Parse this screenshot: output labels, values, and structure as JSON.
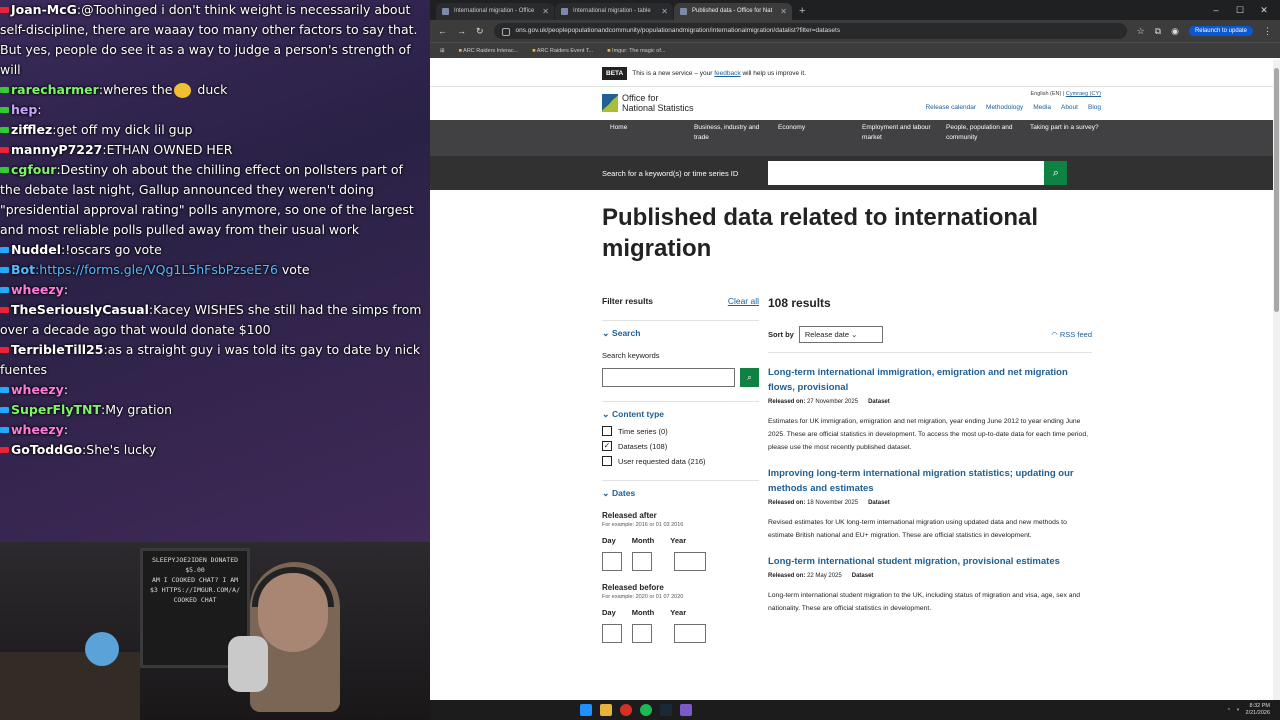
{
  "chat": {
    "messages": [
      {
        "user": "Joan-McG",
        "color": "#ffffff",
        "tick": "#e23",
        "text": ":@Toohinged i don't think weight is necessarily about self-discipline, there are waaay too many other factors to say that. But yes, people do see it as a way to judge a person's strength of will"
      },
      {
        "user": "rarecharmer",
        "color": "#7ef46a",
        "tick": "#3c3",
        "text": ":wheres the",
        "emote": "#f0c030",
        "text2": " duck"
      },
      {
        "user": "hep",
        "color": "#c9a3ff",
        "tick": "#3c3",
        "text": ":"
      },
      {
        "user": "zifflez",
        "color": "#ffffff",
        "tick": "#3c3",
        "text": ":get off my dick lil gup"
      },
      {
        "user": "mannyP7227",
        "color": "#ffffff",
        "tick": "#e23",
        "text": ":ETHAN OWNED HER"
      },
      {
        "user": "cgfour",
        "color": "#7ef46a",
        "tick": "#3c3",
        "text": ":Destiny oh about the chilling effect on pollsters part of the debate last night, Gallup announced they weren't doing \"presidential approval rating\" polls anymore, so one of the largest and most reliable polls pulled away from their usual work"
      },
      {
        "user": "Nuddel",
        "color": "#ffffff",
        "tick": "#2af",
        "text": ":!oscars",
        "text2": " go vote"
      },
      {
        "user": "Bot",
        "color": "#57b7ff",
        "tick": "#2af",
        "text": ":https://forms.gle/VQg1L5hFsbPzseE76",
        "text2": " vote"
      },
      {
        "user": "wheezy",
        "color": "#ff7ad9",
        "tick": "#2af",
        "text": ":"
      },
      {
        "user": "TheSeriouslyCasual",
        "color": "#ffffff",
        "tick": "#e23",
        "text": ":Kacey WISHES she still had the simps from over a decade ago that would donate $100"
      },
      {
        "user": "TerribleTill25",
        "color": "#ffffff",
        "tick": "#e23",
        "text": ":as a straight guy i was told its gay to date by nick fuentes"
      },
      {
        "user": "wheezy",
        "color": "#ff7ad9",
        "tick": "#2af",
        "text": ":"
      },
      {
        "user": "SuperFlyTNT",
        "color": "#7ef46a",
        "tick": "#2af",
        "text": ":My gration"
      },
      {
        "user": "wheezy",
        "color": "#ff7ad9",
        "tick": "#2af",
        "text": ":"
      },
      {
        "user": "GoToddGo",
        "color": "#ffffff",
        "tick": "#e23",
        "text": ":She's lucky"
      }
    ]
  },
  "browser": {
    "tabs": [
      {
        "title": "International migration - Office"
      },
      {
        "title": "International migration - table"
      },
      {
        "title": "Published data - Office for Nat",
        "active": true
      }
    ],
    "url": "ons.gov.uk/peoplepopulationandcommunity/populationandmigration/internationalmigration/datalist?filter=datasets",
    "relaunch": "Relaunch to update",
    "bookmarks": [
      "ARC Raiders Interac...",
      "ARC Raiders Event T...",
      "Imgur: The magic of..."
    ]
  },
  "ons": {
    "beta_tag": "BETA",
    "beta_text": "This is a new service – your",
    "beta_link": "feedback",
    "beta_tail": "will help us improve it.",
    "logo_line1": "Office for",
    "logo_line2": "National Statistics",
    "lang_en": "English (EN)",
    "lang_cy": "Cymraeg (CY)",
    "toplinks": [
      "Release calendar",
      "Methodology",
      "Media",
      "About",
      "Blog"
    ],
    "nav": [
      "Home",
      "Business, industry and trade",
      "Economy",
      "Employment and labour market",
      "People, population and community",
      "Taking part in a survey?"
    ],
    "search_label": "Search for a keyword(s) or time series ID",
    "title": "Published data related to international migration",
    "filter_title": "Filter results",
    "clear_all": "Clear all",
    "search_section": "Search",
    "search_keywords": "Search keywords",
    "content_type": "Content type",
    "checkboxes": [
      {
        "label": "Time series (0)",
        "checked": false
      },
      {
        "label": "Datasets (108)",
        "checked": true
      },
      {
        "label": "User requested data (216)",
        "checked": false
      }
    ],
    "dates": "Dates",
    "released_after": "Released after",
    "after_hint": "For example: 2016 or 01 03 2016",
    "released_before": "Released before",
    "before_hint": "For example: 2020 or 01 07 2020",
    "day": "Day",
    "month": "Month",
    "year": "Year",
    "results_count": "108 results",
    "sort_by": "Sort by",
    "sort_value": "Release date",
    "rss": "RSS feed",
    "results": [
      {
        "title": "Long-term international immigration, emigration and net migration flows, provisional",
        "released_label": "Released on:",
        "date": "27 November 2025",
        "type": "Dataset",
        "desc": "Estimates for UK immigration, emigration and net migration, year ending June 2012 to year ending June 2025. These are official statistics in development. To access the most up-to-date data for each time period, please use the most recently published dataset."
      },
      {
        "title": "Improving long-term international migration statistics; updating our methods and estimates",
        "released_label": "Released on:",
        "date": "18 November 2025",
        "type": "Dataset",
        "desc": "Revised estimates for UK long-term international migration using updated data and new methods to estimate British national and EU+ migration. These are official statistics in development."
      },
      {
        "title": "Long-term international student migration, provisional estimates",
        "released_label": "Released on:",
        "date": "22 May 2025",
        "type": "Dataset",
        "desc": "Long-term international student migration to the UK, including status of migration and visa, age, sex and nationality. These are official statistics in development."
      }
    ]
  },
  "taskbar": {
    "time": "8:32 PM",
    "date": "2/21/2026"
  }
}
